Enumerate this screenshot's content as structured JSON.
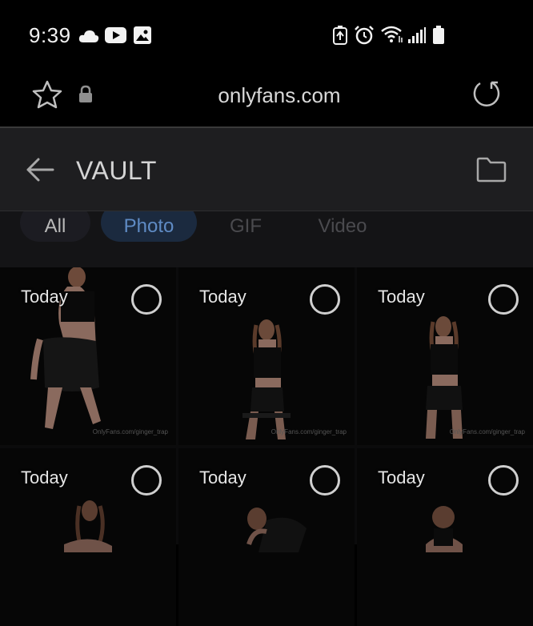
{
  "status_bar": {
    "time": "9:39",
    "left_icons": [
      "cloud-icon",
      "youtube-icon",
      "image-icon"
    ],
    "right_icons": [
      "battery-saver-icon",
      "alarm-icon",
      "wifi-icon",
      "signal-icon",
      "battery-icon"
    ]
  },
  "browser": {
    "url": "onlyfans.com",
    "icons": [
      "star-icon",
      "lock-icon",
      "reload-icon"
    ]
  },
  "appbar": {
    "title": "VAULT",
    "icons": [
      "back-arrow-icon",
      "folder-icon"
    ]
  },
  "tabs": [
    {
      "label": "All",
      "selected": false
    },
    {
      "label": "Photo",
      "selected": true
    },
    {
      "label": "GIF",
      "selected": false
    },
    {
      "label": "Video",
      "selected": false
    }
  ],
  "media": [
    {
      "label": "Today",
      "watermark": "OnlyFans.com/ginger_trap",
      "selected": false
    },
    {
      "label": "Today",
      "watermark": "OnlyFans.com/ginger_trap",
      "selected": false
    },
    {
      "label": "Today",
      "watermark": "OnlyFans.com/ginger_trap",
      "selected": false
    },
    {
      "label": "Today",
      "selected": false
    },
    {
      "label": "Today",
      "selected": false
    },
    {
      "label": "Today",
      "selected": false
    }
  ],
  "colors": {
    "background": "#000000",
    "appbar": "#1e1e20",
    "selected_tab_bg": "#1b2a3f",
    "selected_tab_text": "#5f8bc4"
  }
}
